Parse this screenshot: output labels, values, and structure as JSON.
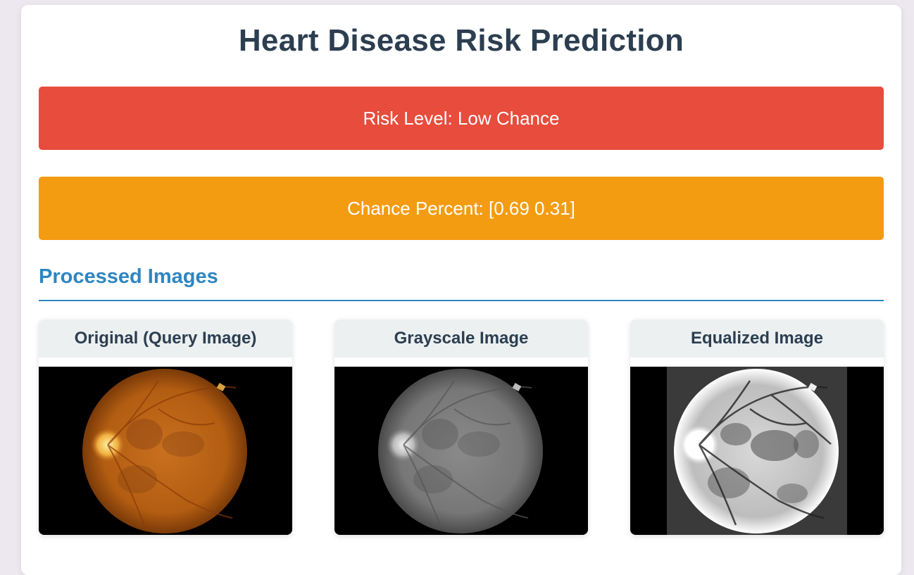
{
  "page": {
    "title": "Heart Disease Risk Prediction"
  },
  "results": {
    "risk_text": "Risk Level: Low Chance",
    "chance_text": "Chance Percent: [0.69 0.31]"
  },
  "section": {
    "title": "Processed Images"
  },
  "images": [
    {
      "label": "Original (Query Image)",
      "kind": "original"
    },
    {
      "label": "Grayscale Image",
      "kind": "grayscale"
    },
    {
      "label": "Equalized Image",
      "kind": "equalized"
    }
  ],
  "colors": {
    "title": "#2c3e50",
    "risk_banner": "#e74c3c",
    "chance_banner": "#f39c12",
    "section_accent": "#2e86c1",
    "card_header": "#ecf0f1"
  }
}
